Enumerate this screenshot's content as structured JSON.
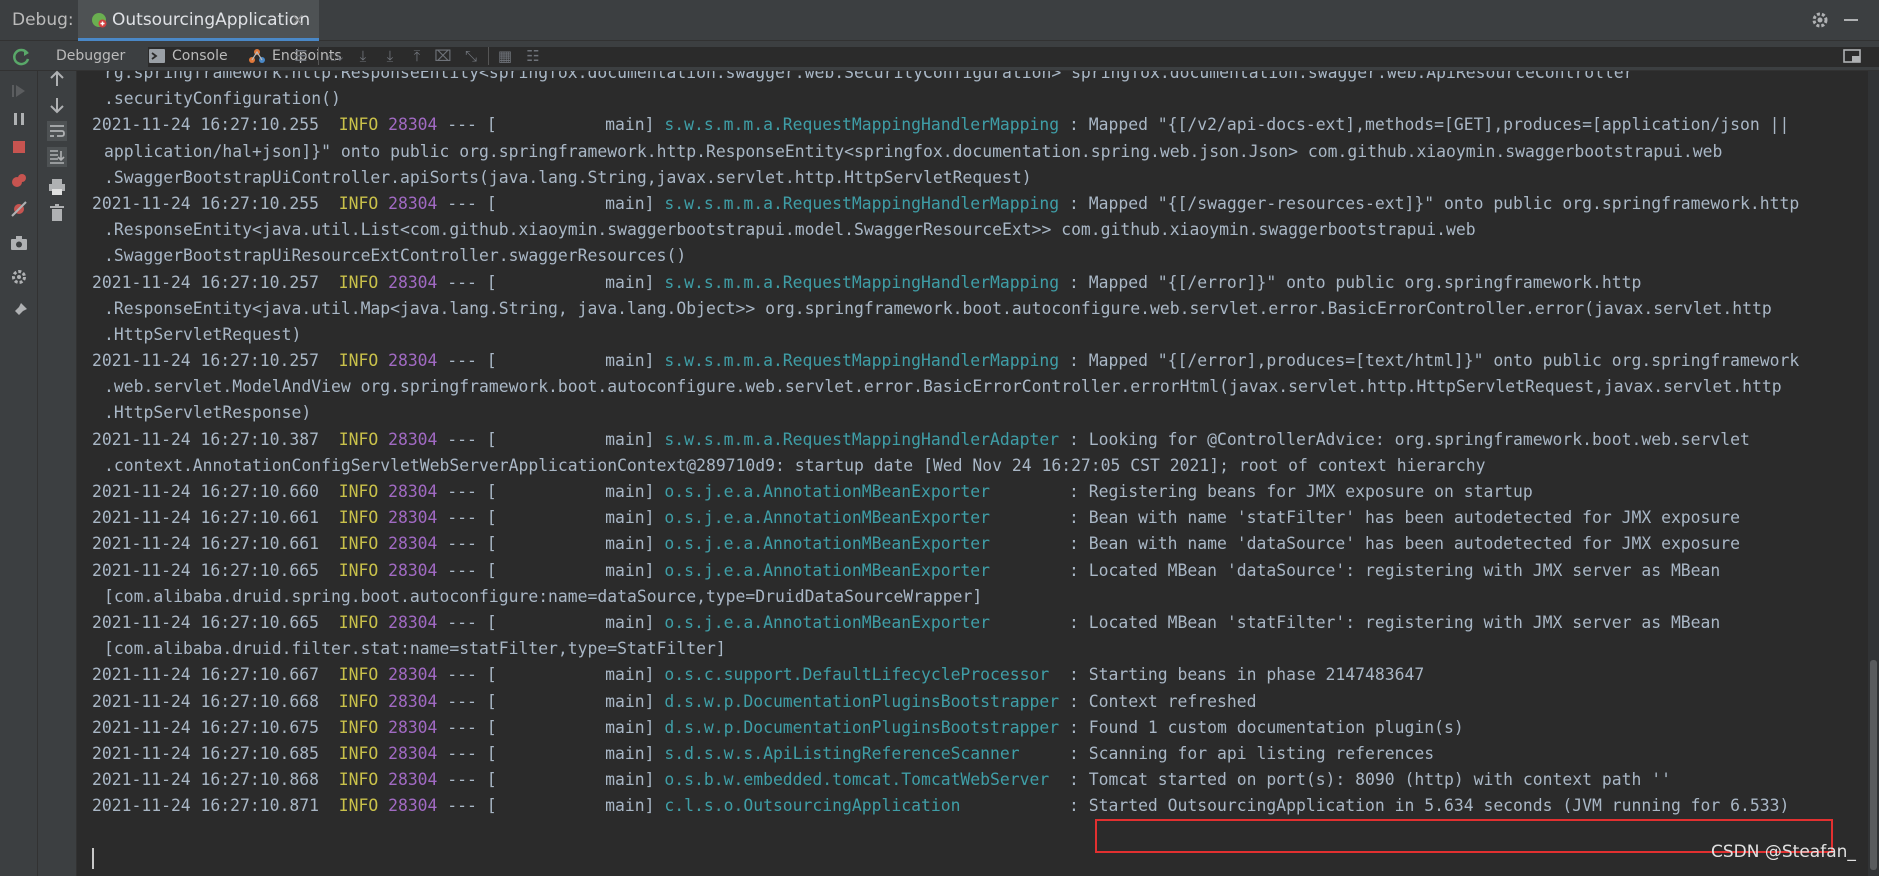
{
  "window": {
    "debug_label": "Debug:",
    "tab_title": "OutsourcingApplication",
    "tab_close": "×"
  },
  "toolbar": {
    "tabs": [
      {
        "label": "Debugger"
      },
      {
        "label": "Console"
      },
      {
        "label": "Endpoints"
      }
    ],
    "icons": [
      "menu-icon",
      "step-over-icon",
      "step-into-icon",
      "force-step-into-icon",
      "step-out-icon",
      "drop-frame-icon",
      "run-to-cursor-icon",
      "evaluate-expression-icon",
      "trace-icon"
    ]
  },
  "gutter_left": [
    "resume-icon",
    "pause-icon",
    "stop-icon",
    "view-breakpoints-icon",
    "mute-breakpoints-icon",
    "camera-icon",
    "settings-icon",
    "pin-icon"
  ],
  "gutter_right": [
    "up-arrow-icon",
    "down-arrow-icon",
    "soft-wrap-icon",
    "scroll-to-end-icon",
    "print-icon",
    "clear-all-icon"
  ],
  "console": {
    "lines": [
      {
        "cont": true,
        "text": "rg.springframework.http.ResponseEntity<springfox.documentation.swagger.web.SecurityConfiguration> springfox.documentation.swagger.web.ApiResourceController"
      },
      {
        "cont": true,
        "text": ".securityConfiguration()"
      },
      {
        "ts": "2021-11-24 16:27:10.255",
        "level": "INFO",
        "pid": "28304",
        "sep": " --- [           main] ",
        "logger": "s.w.s.m.m.a.RequestMappingHandlerMapping",
        "msg": " : Mapped \"{[/v2/api-docs-ext],methods=[GET],produces=[application/json ||"
      },
      {
        "cont": true,
        "text": "application/hal+json]}\" onto public org.springframework.http.ResponseEntity<springfox.documentation.spring.web.json.Json> com.github.xiaoymin.swaggerbootstrapui.web"
      },
      {
        "cont": true,
        "text": ".SwaggerBootstrapUiController.apiSorts(java.lang.String,javax.servlet.http.HttpServletRequest)"
      },
      {
        "ts": "2021-11-24 16:27:10.255",
        "level": "INFO",
        "pid": "28304",
        "sep": " --- [           main] ",
        "logger": "s.w.s.m.m.a.RequestMappingHandlerMapping",
        "msg": " : Mapped \"{[/swagger-resources-ext]}\" onto public org.springframework.http"
      },
      {
        "cont": true,
        "text": ".ResponseEntity<java.util.List<com.github.xiaoymin.swaggerbootstrapui.model.SwaggerResourceExt>> com.github.xiaoymin.swaggerbootstrapui.web"
      },
      {
        "cont": true,
        "text": ".SwaggerBootstrapUiResourceExtController.swaggerResources()"
      },
      {
        "ts": "2021-11-24 16:27:10.257",
        "level": "INFO",
        "pid": "28304",
        "sep": " --- [           main] ",
        "logger": "s.w.s.m.m.a.RequestMappingHandlerMapping",
        "msg": " : Mapped \"{[/error]}\" onto public org.springframework.http"
      },
      {
        "cont": true,
        "text": ".ResponseEntity<java.util.Map<java.lang.String, java.lang.Object>> org.springframework.boot.autoconfigure.web.servlet.error.BasicErrorController.error(javax.servlet.http"
      },
      {
        "cont": true,
        "text": ".HttpServletRequest)"
      },
      {
        "ts": "2021-11-24 16:27:10.257",
        "level": "INFO",
        "pid": "28304",
        "sep": " --- [           main] ",
        "logger": "s.w.s.m.m.a.RequestMappingHandlerMapping",
        "msg": " : Mapped \"{[/error],produces=[text/html]}\" onto public org.springframework"
      },
      {
        "cont": true,
        "text": ".web.servlet.ModelAndView org.springframework.boot.autoconfigure.web.servlet.error.BasicErrorController.errorHtml(javax.servlet.http.HttpServletRequest,javax.servlet.http"
      },
      {
        "cont": true,
        "text": ".HttpServletResponse)"
      },
      {
        "ts": "2021-11-24 16:27:10.387",
        "level": "INFO",
        "pid": "28304",
        "sep": " --- [           main] ",
        "logger": "s.w.s.m.m.a.RequestMappingHandlerAdapter",
        "msg": " : Looking for @ControllerAdvice: org.springframework.boot.web.servlet"
      },
      {
        "cont": true,
        "text": ".context.AnnotationConfigServletWebServerApplicationContext@289710d9: startup date [Wed Nov 24 16:27:05 CST 2021]; root of context hierarchy"
      },
      {
        "ts": "2021-11-24 16:27:10.660",
        "level": "INFO",
        "pid": "28304",
        "sep": " --- [           main] ",
        "logger": "o.s.j.e.a.AnnotationMBeanExporter       ",
        "msg": " : Registering beans for JMX exposure on startup"
      },
      {
        "ts": "2021-11-24 16:27:10.661",
        "level": "INFO",
        "pid": "28304",
        "sep": " --- [           main] ",
        "logger": "o.s.j.e.a.AnnotationMBeanExporter       ",
        "msg": " : Bean with name 'statFilter' has been autodetected for JMX exposure"
      },
      {
        "ts": "2021-11-24 16:27:10.661",
        "level": "INFO",
        "pid": "28304",
        "sep": " --- [           main] ",
        "logger": "o.s.j.e.a.AnnotationMBeanExporter       ",
        "msg": " : Bean with name 'dataSource' has been autodetected for JMX exposure"
      },
      {
        "ts": "2021-11-24 16:27:10.665",
        "level": "INFO",
        "pid": "28304",
        "sep": " --- [           main] ",
        "logger": "o.s.j.e.a.AnnotationMBeanExporter       ",
        "msg": " : Located MBean 'dataSource': registering with JMX server as MBean"
      },
      {
        "cont": true,
        "text": "[com.alibaba.druid.spring.boot.autoconfigure:name=dataSource,type=DruidDataSourceWrapper]"
      },
      {
        "ts": "2021-11-24 16:27:10.665",
        "level": "INFO",
        "pid": "28304",
        "sep": " --- [           main] ",
        "logger": "o.s.j.e.a.AnnotationMBeanExporter       ",
        "msg": " : Located MBean 'statFilter': registering with JMX server as MBean"
      },
      {
        "cont": true,
        "text": "[com.alibaba.druid.filter.stat:name=statFilter,type=StatFilter]"
      },
      {
        "ts": "2021-11-24 16:27:10.667",
        "level": "INFO",
        "pid": "28304",
        "sep": " --- [           main] ",
        "logger": "o.s.c.support.DefaultLifecycleProcessor ",
        "msg": " : Starting beans in phase 2147483647"
      },
      {
        "ts": "2021-11-24 16:27:10.668",
        "level": "INFO",
        "pid": "28304",
        "sep": " --- [           main] ",
        "logger": "d.s.w.p.DocumentationPluginsBootstrapper",
        "msg": " : Context refreshed"
      },
      {
        "ts": "2021-11-24 16:27:10.675",
        "level": "INFO",
        "pid": "28304",
        "sep": " --- [           main] ",
        "logger": "d.s.w.p.DocumentationPluginsBootstrapper",
        "msg": " : Found 1 custom documentation plugin(s)"
      },
      {
        "ts": "2021-11-24 16:27:10.685",
        "level": "INFO",
        "pid": "28304",
        "sep": " --- [           main] ",
        "logger": "s.d.s.w.s.ApiListingReferenceScanner    ",
        "msg": " : Scanning for api listing references"
      },
      {
        "ts": "2021-11-24 16:27:10.868",
        "level": "INFO",
        "pid": "28304",
        "sep": " --- [           main] ",
        "logger": "o.s.b.w.embedded.tomcat.TomcatWebServer ",
        "msg": " : Tomcat started on port(s): 8090 (http) with context path ''"
      },
      {
        "ts": "2021-11-24 16:27:10.871",
        "level": "INFO",
        "pid": "28304",
        "sep": " --- [           main] ",
        "logger": "c.l.s.o.OutsourcingApplication          ",
        "msg": " : Started OutsourcingApplication in 5.634 seconds (JVM running for 6.533)"
      }
    ]
  },
  "watermark": "CSDN @Steafan_",
  "colors": {
    "info": "#c9c14a",
    "pid": "#a16ac3",
    "logger": "#3f9ea7",
    "highlight": "#e23030"
  }
}
